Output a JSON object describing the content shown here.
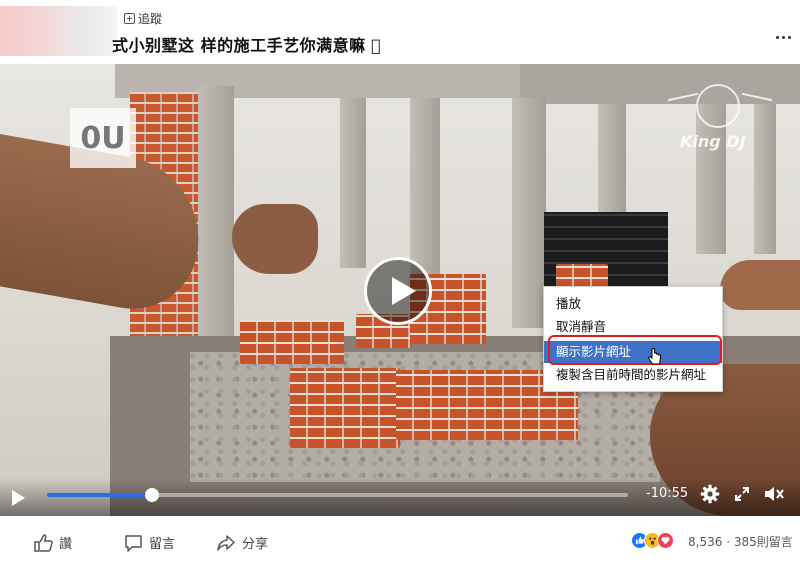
{
  "header": {
    "follow_label": "追蹤",
    "title": "式小别墅这 样的施工手艺你满意嘛 🏻"
  },
  "video": {
    "overlay_logo_text": "0U",
    "watermark_text": "King DJ",
    "context_menu": {
      "items": [
        {
          "label": "播放"
        },
        {
          "label": "取消靜音"
        },
        {
          "label": "顯示影片網址",
          "highlighted": true
        },
        {
          "label": "複製含目前時間的影片網址"
        }
      ]
    },
    "controls": {
      "time_remaining": "-10:55",
      "progress_fraction": 0.18
    }
  },
  "footer": {
    "like_label": "讚",
    "comment_label": "留言",
    "share_label": "分享",
    "reaction_count": "8,536",
    "comment_count": "385則留言"
  },
  "colors": {
    "accent": "#1877f2",
    "progress": "#2d6be4",
    "menu_highlight": "#3f72c6",
    "annotation_ring": "#e01c1c"
  },
  "icons": [
    "follow-plus-icon",
    "more-dots-icon",
    "play-icon",
    "gear-icon",
    "fullscreen-icon",
    "volume-icon",
    "like-icon",
    "comment-icon",
    "share-icon",
    "cursor-icon"
  ]
}
